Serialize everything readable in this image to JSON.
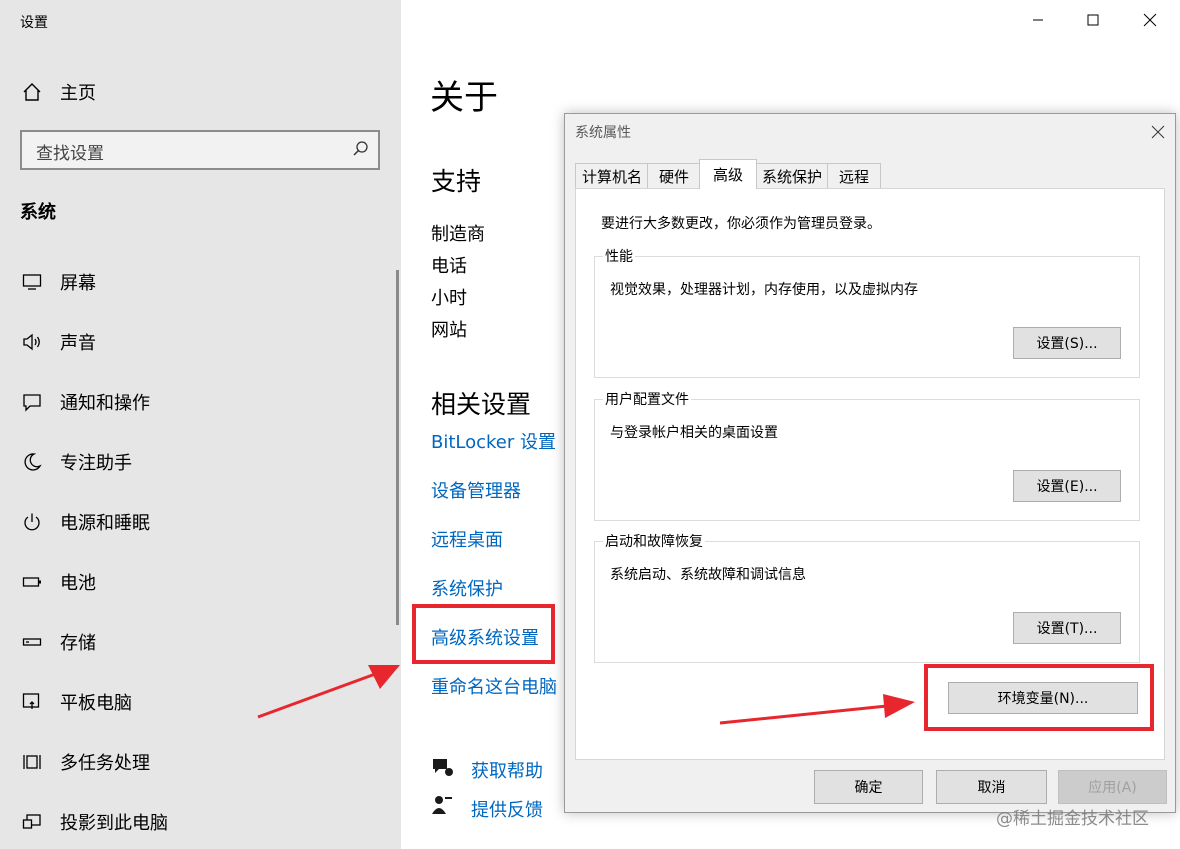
{
  "window": {
    "title": "设置",
    "controls": [
      "minimize-icon",
      "maximize-icon",
      "close-icon"
    ]
  },
  "sidebar": {
    "home_label": "主页",
    "search_placeholder": "查找设置",
    "section_title": "系统",
    "items": [
      {
        "label": "屏幕",
        "icon": "monitor-icon"
      },
      {
        "label": "声音",
        "icon": "speaker-icon"
      },
      {
        "label": "通知和操作",
        "icon": "notification-icon"
      },
      {
        "label": "专注助手",
        "icon": "moon-icon"
      },
      {
        "label": "电源和睡眠",
        "icon": "power-icon"
      },
      {
        "label": "电池",
        "icon": "battery-icon"
      },
      {
        "label": "存储",
        "icon": "storage-icon"
      },
      {
        "label": "平板电脑",
        "icon": "tablet-icon"
      },
      {
        "label": "多任务处理",
        "icon": "multitask-icon"
      },
      {
        "label": "投影到此电脑",
        "icon": "project-icon"
      }
    ]
  },
  "main": {
    "title": "关于",
    "support": {
      "heading": "支持",
      "items": [
        "制造商",
        "电话",
        "小时",
        "网站"
      ]
    },
    "related": {
      "heading": "相关设置",
      "links": [
        "BitLocker 设置",
        "设备管理器",
        "远程桌面",
        "系统保护",
        "高级系统设置",
        "重命名这台电脑"
      ]
    },
    "help": {
      "get_help": "获取帮助",
      "feedback": "提供反馈"
    }
  },
  "dialog": {
    "title": "系统属性",
    "tabs": [
      "计算机名",
      "硬件",
      "高级",
      "系统保护",
      "远程"
    ],
    "active_tab": "高级",
    "admin_notice": "要进行大多数更改，你必须作为管理员登录。",
    "groups": [
      {
        "label": "性能",
        "desc": "视觉效果，处理器计划，内存使用，以及虚拟内存",
        "button": "设置(S)..."
      },
      {
        "label": "用户配置文件",
        "desc": "与登录帐户相关的桌面设置",
        "button": "设置(E)..."
      },
      {
        "label": "启动和故障恢复",
        "desc": "系统启动、系统故障和调试信息",
        "button": "设置(T)..."
      }
    ],
    "env_button": "环境变量(N)...",
    "ok": "确定",
    "cancel": "取消",
    "apply": "应用(A)"
  },
  "watermark": "@稀土掘金技术社区",
  "colors": {
    "accent": "#0067c0",
    "highlight": "#e8262e",
    "sidebar_bg": "#e6e6e6"
  }
}
